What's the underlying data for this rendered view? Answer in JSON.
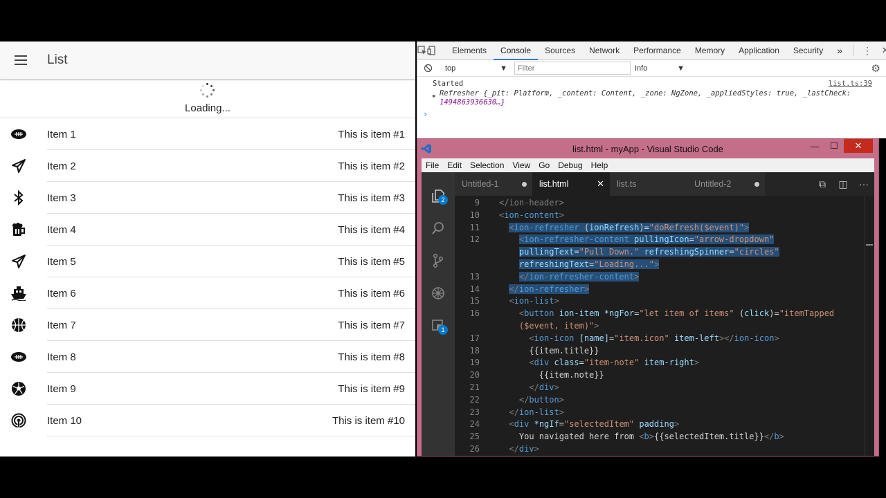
{
  "app": {
    "title": "List",
    "refresher_text": "Loading...",
    "items": [
      {
        "icon": "american-football-icon",
        "title": "Item 1",
        "note": "This is item #1"
      },
      {
        "icon": "paper-plane-icon",
        "title": "Item 2",
        "note": "This is item #2"
      },
      {
        "icon": "bluetooth-icon",
        "title": "Item 3",
        "note": "This is item #3"
      },
      {
        "icon": "beer-icon",
        "title": "Item 4",
        "note": "This is item #4"
      },
      {
        "icon": "paper-plane-icon",
        "title": "Item 5",
        "note": "This is item #5"
      },
      {
        "icon": "boat-icon",
        "title": "Item 6",
        "note": "This is item #6"
      },
      {
        "icon": "basketball-icon",
        "title": "Item 7",
        "note": "This is item #7"
      },
      {
        "icon": "american-football-icon",
        "title": "Item 8",
        "note": "This is item #8"
      },
      {
        "icon": "football-icon",
        "title": "Item 9",
        "note": "This is item #9"
      },
      {
        "icon": "wifi-icon",
        "title": "Item 10",
        "note": "This is item #10"
      }
    ]
  },
  "devtools": {
    "tabs": [
      "Elements",
      "Console",
      "Sources",
      "Network",
      "Performance",
      "Memory",
      "Application",
      "Security"
    ],
    "active_tab": "Console",
    "more": "»",
    "context": "top",
    "filter_placeholder": "Filter",
    "levels": "Info",
    "console": {
      "line1": "Started",
      "line1_src": "list.ts:39",
      "obj_name": "Refresher",
      "obj_body_1": " {_pit: Platform, _content: Content, _zone: NgZone, _appliedStyles: true, _lastCheck:",
      "obj_body_2": "1494863936630…}",
      "prompt": "›"
    }
  },
  "vscode": {
    "window_title": "list.html - myApp - Visual Studio Code",
    "menu": [
      "File",
      "Edit",
      "Selection",
      "View",
      "Go",
      "Debug",
      "Help"
    ],
    "tabs": [
      {
        "label": "Untitled-1",
        "modified": true,
        "active": false
      },
      {
        "label": "list.html",
        "modified": false,
        "active": true
      },
      {
        "label": "list.ts",
        "modified": false,
        "active": false
      },
      {
        "label": "Untitled-2",
        "modified": true,
        "active": false
      }
    ],
    "badges": {
      "explorer": "2",
      "extensions": "1"
    },
    "code_lines": [
      {
        "n": "9",
        "html": "<span class='gy'>&lt;/ion-header&gt;</span>",
        "sel": false
      },
      {
        "n": "10",
        "html": "<span class='gy'>&lt;</span><span class='tg'>ion-content</span><span class='gy'>&gt;</span>",
        "sel": false
      },
      {
        "n": "11",
        "html": "  <span class='sel'><span class='gy'>&lt;</span><span class='tg'>ion-refresher</span> <span class='pl'>(</span><span class='at'>ionRefresh</span><span class='pl'>)=</span><span class='st'>\"doRefresh($event)\"</span><span class='gy'>&gt;</span></span>",
        "sel": true
      },
      {
        "n": "12",
        "html": "    <span class='sel'><span class='gy'>&lt;</span><span class='tg'>ion-refresher-content</span> <span class='at'>pullingIcon</span><span class='pl'>=</span><span class='st'>\"arrow-dropdown\"</span></span>",
        "sel": true
      },
      {
        "n": "",
        "html": "    <span class='sel'><span class='at'>pullingText</span><span class='pl'>=</span><span class='st'>\"Pull Down.\"</span> <span class='at'>refreshingSpinner</span><span class='pl'>=</span><span class='st'>\"circles\"</span></span>",
        "sel": true
      },
      {
        "n": "",
        "html": "    <span class='sel'><span class='at'>refreshingText</span><span class='pl'>=</span><span class='st'>\"Loading...\"</span><span class='gy'>&gt;</span></span>",
        "sel": true
      },
      {
        "n": "13",
        "html": "    <span class='sel'><span class='gy'>&lt;/</span><span class='tg'>ion-refresher-content</span><span class='gy'>&gt;</span></span>",
        "sel": true
      },
      {
        "n": "14",
        "html": "  <span class='sel'><span class='gy'>&lt;/</span><span class='tg'>ion-refresher</span><span class='gy'>&gt;</span></span>",
        "sel": true
      },
      {
        "n": "15",
        "html": "  <span class='gy'>&lt;</span><span class='tg'>ion-list</span><span class='gy'>&gt;</span>",
        "sel": false
      },
      {
        "n": "16",
        "html": "    <span class='gy'>&lt;</span><span class='tg'>button</span> <span class='at'>ion-item</span> <span class='at'>*ngFor</span><span class='pl'>=</span><span class='st'>\"let item of items\"</span> <span class='pl'>(</span><span class='at'>click</span><span class='pl'>)=</span><span class='st'>\"itemTapped</span>",
        "sel": false
      },
      {
        "n": "",
        "html": "    <span class='st'>($event, item)\"</span><span class='gy'>&gt;</span>",
        "sel": false
      },
      {
        "n": "17",
        "html": "      <span class='gy'>&lt;</span><span class='tg'>ion-icon</span> <span class='at'>[name]</span><span class='pl'>=</span><span class='st'>\"item.icon\"</span> <span class='at'>item-left</span><span class='gy'>&gt;&lt;/</span><span class='tg'>ion-icon</span><span class='gy'>&gt;</span>",
        "sel": false
      },
      {
        "n": "18",
        "html": "      <span class='pl'>{{item.title}}</span>",
        "sel": false
      },
      {
        "n": "19",
        "html": "      <span class='gy'>&lt;</span><span class='tg'>div</span> <span class='at'>class</span><span class='pl'>=</span><span class='st'>\"item-note\"</span> <span class='at'>item-right</span><span class='gy'>&gt;</span>",
        "sel": false
      },
      {
        "n": "20",
        "html": "        <span class='pl'>{{item.note}}</span>",
        "sel": false
      },
      {
        "n": "21",
        "html": "      <span class='gy'>&lt;/</span><span class='tg'>div</span><span class='gy'>&gt;</span>",
        "sel": false
      },
      {
        "n": "22",
        "html": "    <span class='gy'>&lt;/</span><span class='tg'>button</span><span class='gy'>&gt;</span>",
        "sel": false
      },
      {
        "n": "23",
        "html": "  <span class='gy'>&lt;/</span><span class='tg'>ion-list</span><span class='gy'>&gt;</span>",
        "sel": false
      },
      {
        "n": "24",
        "html": "  <span class='gy'>&lt;</span><span class='tg'>div</span> <span class='at'>*ngIf</span><span class='pl'>=</span><span class='st'>\"selectedItem\"</span> <span class='at'>padding</span><span class='gy'>&gt;</span>",
        "sel": false
      },
      {
        "n": "25",
        "html": "    <span class='pl'>You navigated here from </span><span class='gy'>&lt;</span><span class='tg'>b</span><span class='gy'>&gt;</span><span class='pl'>{{selectedItem.title}}</span><span class='gy'>&lt;/</span><span class='tg'>b</span><span class='gy'>&gt;</span>",
        "sel": false
      },
      {
        "n": "26",
        "html": "  <span class='gy'>&lt;/</span><span class='tg'>div</span><span class='gy'>&gt;</span>",
        "sel": false
      }
    ]
  },
  "colors": {
    "vscode_frame": "#c46e8a",
    "vscode_bg": "#1e1e1e",
    "selection": "#264f78",
    "devtools_accent": "#3879d9",
    "close_button": "#c42b1c"
  }
}
